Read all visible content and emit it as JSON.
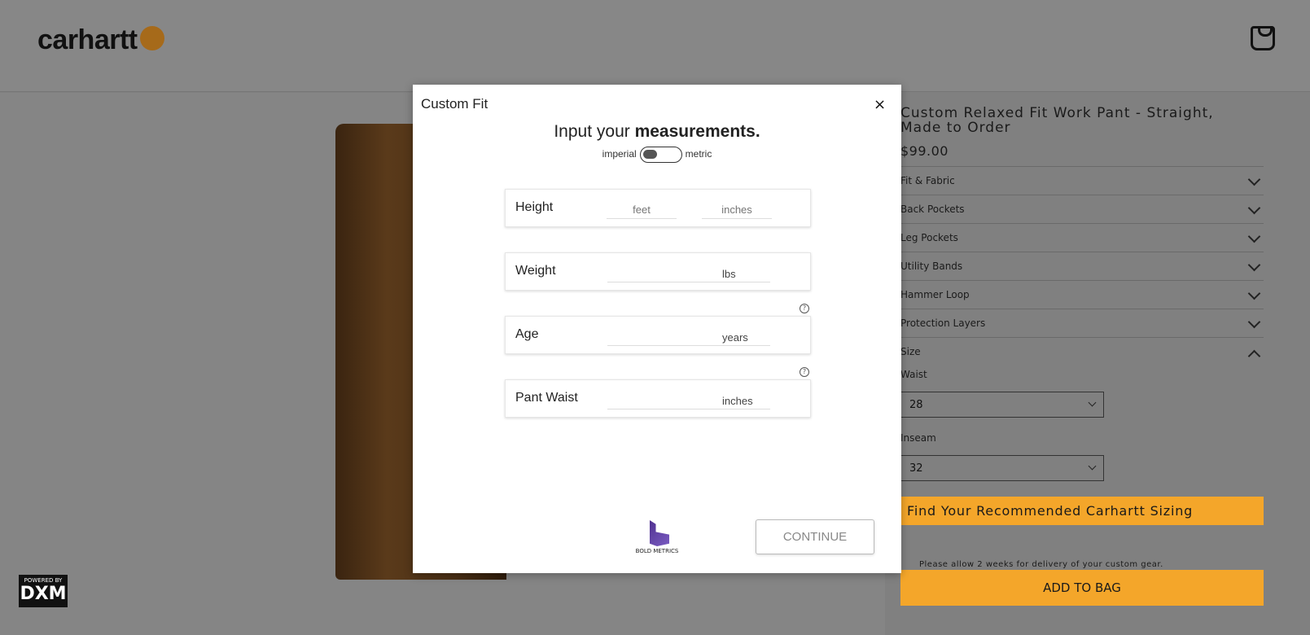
{
  "header": {
    "logo": "carhartt",
    "cart_icon": "shopping-bag-icon"
  },
  "badge": {
    "top": "POWERED BY",
    "main": "DXM"
  },
  "product": {
    "title": "Custom Relaxed Fit Work Pant - Straight, Made to Order",
    "price": "$99.00",
    "sections": [
      "Fit & Fabric",
      "Back Pockets",
      "Leg Pockets",
      "Utility Bands",
      "Hammer Loop",
      "Protection Layers"
    ],
    "size_label": "Size",
    "waist_label": "Waist",
    "waist_value": "28",
    "inseam_label": "Inseam",
    "inseam_value": "32",
    "find_sizing": "Find Your Recommended Carhartt Sizing",
    "delivery_note": "Please allow 2 weeks for delivery of your custom gear.",
    "add_to_bag": "ADD TO BAG",
    "accent": "#f4a62a"
  },
  "modal": {
    "title": "Custom Fit",
    "close": "×",
    "heading_plain": "Input your ",
    "heading_bold": "measurements.",
    "toggle_left": "imperial",
    "toggle_right": "metric",
    "unit_system": "imperial",
    "fields": {
      "height": {
        "label": "Height",
        "feet_placeholder": "feet",
        "inches_placeholder": "inches"
      },
      "weight": {
        "label": "Weight",
        "unit": "lbs"
      },
      "age": {
        "label": "Age",
        "unit": "years"
      },
      "waist": {
        "label": "Pant Waist",
        "unit": "inches"
      }
    },
    "help": "?",
    "brand": "BOLD METRICS",
    "continue": "CONTINUE"
  }
}
